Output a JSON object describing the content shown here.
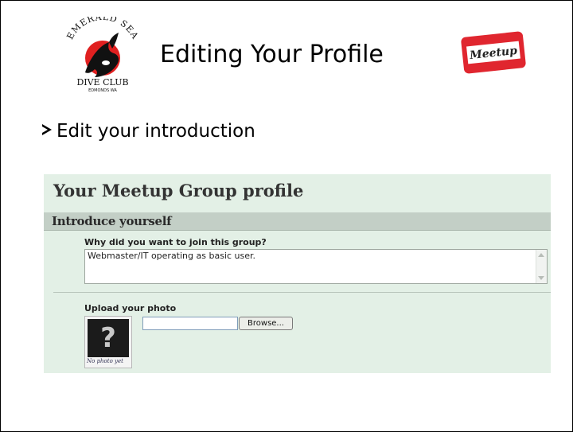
{
  "slide": {
    "title": "Editing Your Profile",
    "bullet": "Edit your introduction",
    "club_logo_text": [
      "EMERALD SEA",
      "DIVE CLUB",
      "EDMONDS WA"
    ],
    "meetup_logo_text": "Meetup"
  },
  "screenshot": {
    "heading": "Your Meetup Group profile",
    "section_title": "Introduce yourself",
    "question_label": "Why did you want to join this group?",
    "intro_value": "Webmaster/IT operating as basic user.",
    "upload_label": "Upload your photo",
    "photo_placeholder": "?",
    "photo_caption": "No photo yet",
    "file_input_value": "",
    "browse_label": "Browse..."
  },
  "colors": {
    "screenshot_bg": "#e3f0e6",
    "section_bar": "#c3cfc6",
    "orca_red": "#e02020",
    "meetup_red": "#e0262f"
  }
}
